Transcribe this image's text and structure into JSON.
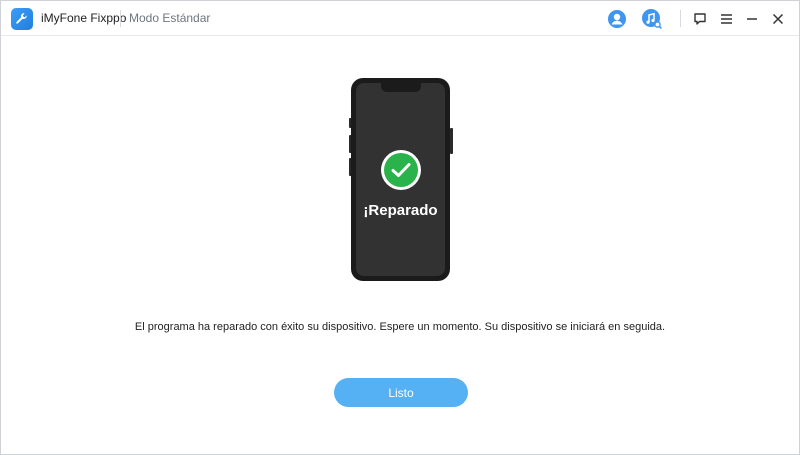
{
  "app": {
    "name": "iMyFone Fixppo",
    "mode": "Modo Estándar"
  },
  "toolbar": {
    "icons": [
      "user-icon",
      "music-search-icon",
      "feedback-icon",
      "menu-icon",
      "minimize-icon",
      "close-icon"
    ]
  },
  "status": {
    "device_label": "¡Reparado",
    "message": "El programa ha reparado con éxito su dispositivo. Espere un momento. Su dispositivo se iniciará en seguida."
  },
  "actions": {
    "done_label": "Listo"
  },
  "colors": {
    "accent": "#55b0f4",
    "success": "#29b34a",
    "icon_blue": "#3f96ee"
  }
}
